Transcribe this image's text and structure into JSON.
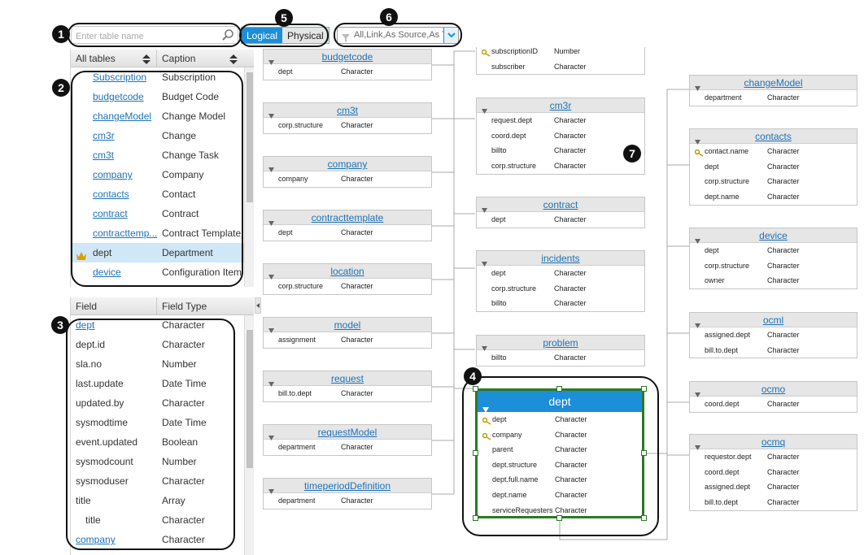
{
  "toolbar": {
    "search_placeholder": "Enter table name",
    "view_logical": "Logical",
    "view_physical": "Physical",
    "filter_text": "All,Link,As Source,As T"
  },
  "callouts": [
    "1",
    "2",
    "3",
    "4",
    "5",
    "6",
    "7"
  ],
  "tables_panel": {
    "headers": [
      "All tables",
      "Caption"
    ],
    "rows": [
      {
        "name": "Subscription",
        "caption": "Subscription"
      },
      {
        "name": "budgetcode",
        "caption": "Budget Code"
      },
      {
        "name": "changeModel",
        "caption": "Change Model"
      },
      {
        "name": "cm3r",
        "caption": "Change"
      },
      {
        "name": "cm3t",
        "caption": "Change Task"
      },
      {
        "name": "company",
        "caption": "Company"
      },
      {
        "name": "contacts",
        "caption": "Contact"
      },
      {
        "name": "contract",
        "caption": "Contract"
      },
      {
        "name": "contracttemp...",
        "caption": "Contract Template"
      },
      {
        "name": "dept",
        "caption": "Department"
      },
      {
        "name": "device",
        "caption": "Configuration Item"
      }
    ]
  },
  "fields_panel": {
    "headers": [
      "Field",
      "Field Type"
    ],
    "rows": [
      {
        "name": "dept",
        "type": "Character"
      },
      {
        "name": "dept.id",
        "type": "Character"
      },
      {
        "name": "sla.no",
        "type": "Number"
      },
      {
        "name": "last.update",
        "type": "Date Time"
      },
      {
        "name": "updated.by",
        "type": "Character"
      },
      {
        "name": "sysmodtime",
        "type": "Date Time"
      },
      {
        "name": "event.updated",
        "type": "Boolean"
      },
      {
        "name": "sysmodcount",
        "type": "Number"
      },
      {
        "name": "sysmoduser",
        "type": "Character"
      },
      {
        "name": "title",
        "type": "Array"
      },
      {
        "name": "title",
        "type": "Character"
      },
      {
        "name": "company",
        "type": "Character"
      }
    ]
  },
  "diagram": {
    "budgetcode": {
      "title": "budgetcode",
      "fields": [
        [
          "dept",
          "Character"
        ]
      ]
    },
    "cm3t": {
      "title": "cm3t",
      "fields": [
        [
          "corp.structure",
          "Character"
        ]
      ]
    },
    "company": {
      "title": "company",
      "fields": [
        [
          "company",
          "Character"
        ]
      ]
    },
    "contracttemplate": {
      "title": "contracttemplate",
      "fields": [
        [
          "dept",
          "Character"
        ]
      ]
    },
    "location": {
      "title": "location",
      "fields": [
        [
          "corp.structure",
          "Character"
        ]
      ]
    },
    "model": {
      "title": "model",
      "fields": [
        [
          "assignment",
          "Character"
        ]
      ]
    },
    "request": {
      "title": "request",
      "fields": [
        [
          "bill.to.dept",
          "Character"
        ]
      ]
    },
    "requestModel": {
      "title": "requestModel",
      "fields": [
        [
          "department",
          "Character"
        ]
      ]
    },
    "timeperiodDefinition": {
      "title": "timeperiodDefinition",
      "fields": [
        [
          "department",
          "Character"
        ]
      ]
    },
    "subscription": {
      "title": "",
      "fields": [
        [
          "subscriptionID",
          "Number"
        ],
        [
          "subscriber",
          "Character"
        ]
      ]
    },
    "cm3r": {
      "title": "cm3r",
      "fields": [
        [
          "request.dept",
          "Character"
        ],
        [
          "coord.dept",
          "Character"
        ],
        [
          "billto",
          "Character"
        ],
        [
          "corp.structure",
          "Character"
        ]
      ]
    },
    "contract": {
      "title": "contract",
      "fields": [
        [
          "dept",
          "Character"
        ]
      ]
    },
    "incidents": {
      "title": "incidents",
      "fields": [
        [
          "dept",
          "Character"
        ],
        [
          "corp.structure",
          "Character"
        ],
        [
          "billto",
          "Character"
        ]
      ]
    },
    "problem": {
      "title": "problem",
      "fields": [
        [
          "billto",
          "Character"
        ]
      ]
    },
    "dept": {
      "title": "dept",
      "fields": [
        [
          "dept",
          "Character"
        ],
        [
          "company",
          "Character"
        ],
        [
          "parent",
          "Character"
        ],
        [
          "dept.structure",
          "Character"
        ],
        [
          "dept.full.name",
          "Character"
        ],
        [
          "dept.name",
          "Character"
        ],
        [
          "serviceRequesters",
          "Character"
        ]
      ]
    },
    "changeModel": {
      "title": "changeModel",
      "fields": [
        [
          "department",
          "Character"
        ]
      ]
    },
    "contacts": {
      "title": "contacts",
      "fields": [
        [
          "contact.name",
          "Character"
        ],
        [
          "dept",
          "Character"
        ],
        [
          "corp.structure",
          "Character"
        ],
        [
          "dept.name",
          "Character"
        ]
      ]
    },
    "device": {
      "title": "device",
      "fields": [
        [
          "dept",
          "Character"
        ],
        [
          "corp.structure",
          "Character"
        ],
        [
          "owner",
          "Character"
        ]
      ]
    },
    "ocml": {
      "title": "ocml",
      "fields": [
        [
          "assigned.dept",
          "Character"
        ],
        [
          "bill.to.dept",
          "Character"
        ]
      ]
    },
    "ocmo": {
      "title": "ocmo",
      "fields": [
        [
          "coord.dept",
          "Character"
        ]
      ]
    },
    "ocmq": {
      "title": "ocmq",
      "fields": [
        [
          "requestor.dept",
          "Character"
        ],
        [
          "coord.dept",
          "Character"
        ],
        [
          "assigned.dept",
          "Character"
        ],
        [
          "bill.to.dept",
          "Character"
        ]
      ]
    }
  }
}
